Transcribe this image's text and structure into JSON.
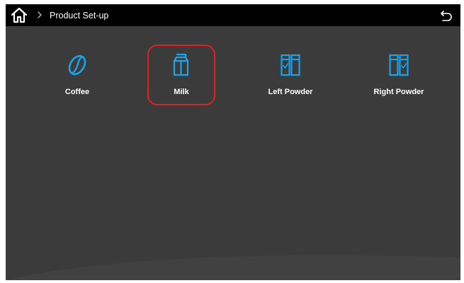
{
  "header": {
    "home_icon": "home-icon",
    "separator_icon": "chevron-right-icon",
    "title": "Product Set-up",
    "back_icon": "back-arrow-icon"
  },
  "products": [
    {
      "label": "Coffee",
      "icon": "coffee-bean-icon",
      "selected": false
    },
    {
      "label": "Milk",
      "icon": "milk-carton-icon",
      "selected": true
    },
    {
      "label": "Left Powder",
      "icon": "left-powder-icon",
      "selected": false
    },
    {
      "label": "Right Powder",
      "icon": "right-powder-icon",
      "selected": false
    }
  ],
  "colors": {
    "background": "#3b3b3b",
    "topbar": "#000000",
    "icon_accent": "#1aa3e8",
    "selection_border": "#e31f1f",
    "text": "#ffffff"
  }
}
